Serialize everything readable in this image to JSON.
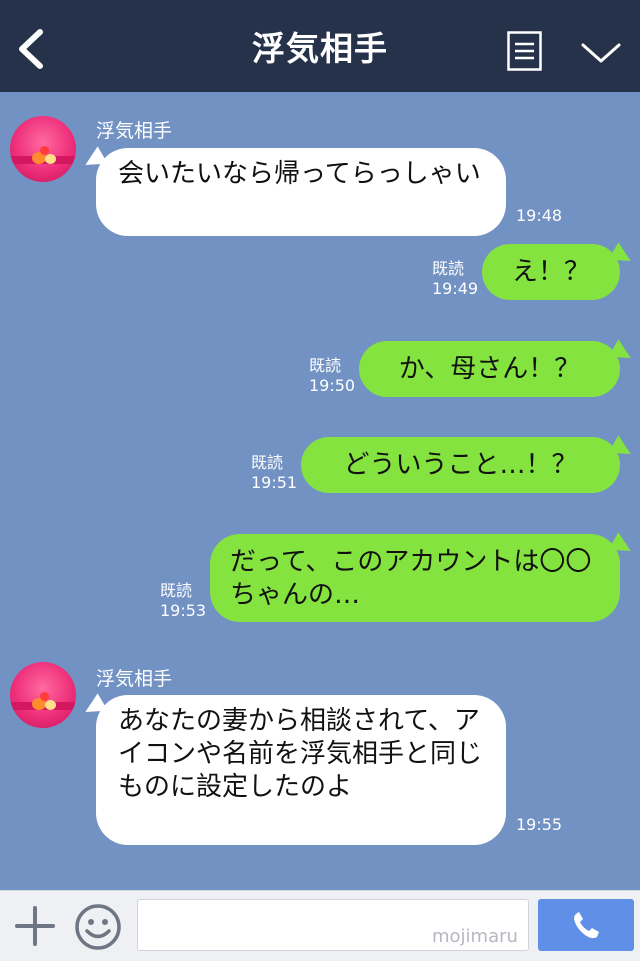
{
  "header": {
    "title": "浮気相手",
    "back_icon": "chevron-left-icon",
    "menu_icon": "menu-icon",
    "collapse_icon": "chevron-down-icon",
    "bg_color": "#263249"
  },
  "chat": {
    "bg_color": "#7192c3",
    "messages": [
      {
        "side": "left",
        "sender": "浮気相手",
        "text": "会いたいなら帰ってらっしゃい",
        "time": "19:48"
      },
      {
        "side": "right",
        "read": "既読",
        "text": "え！？",
        "time": "19:49"
      },
      {
        "side": "right",
        "read": "既読",
        "text": "か、母さん！？",
        "time": "19:50"
      },
      {
        "side": "right",
        "read": "既読",
        "text": "どういうこと…！？",
        "time": "19:51"
      },
      {
        "side": "right",
        "read": "既読",
        "text": "だって、このアカウントは〇〇ちゃんの…",
        "time": "19:53"
      },
      {
        "side": "left",
        "sender": "浮気相手",
        "text": "あなたの妻から相談されて、アイコンや名前を浮気相手と同じものに設定したのよ",
        "time": "19:55"
      }
    ]
  },
  "input_bar": {
    "plus_icon": "plus-icon",
    "emoji_icon": "smiley-icon",
    "input_value": "",
    "watermark": "mojimaru",
    "call_icon": "phone-icon",
    "call_color": "#5f8fe6"
  },
  "colors": {
    "outgoing_bubble": "#84e33f",
    "incoming_bubble": "#ffffff"
  }
}
